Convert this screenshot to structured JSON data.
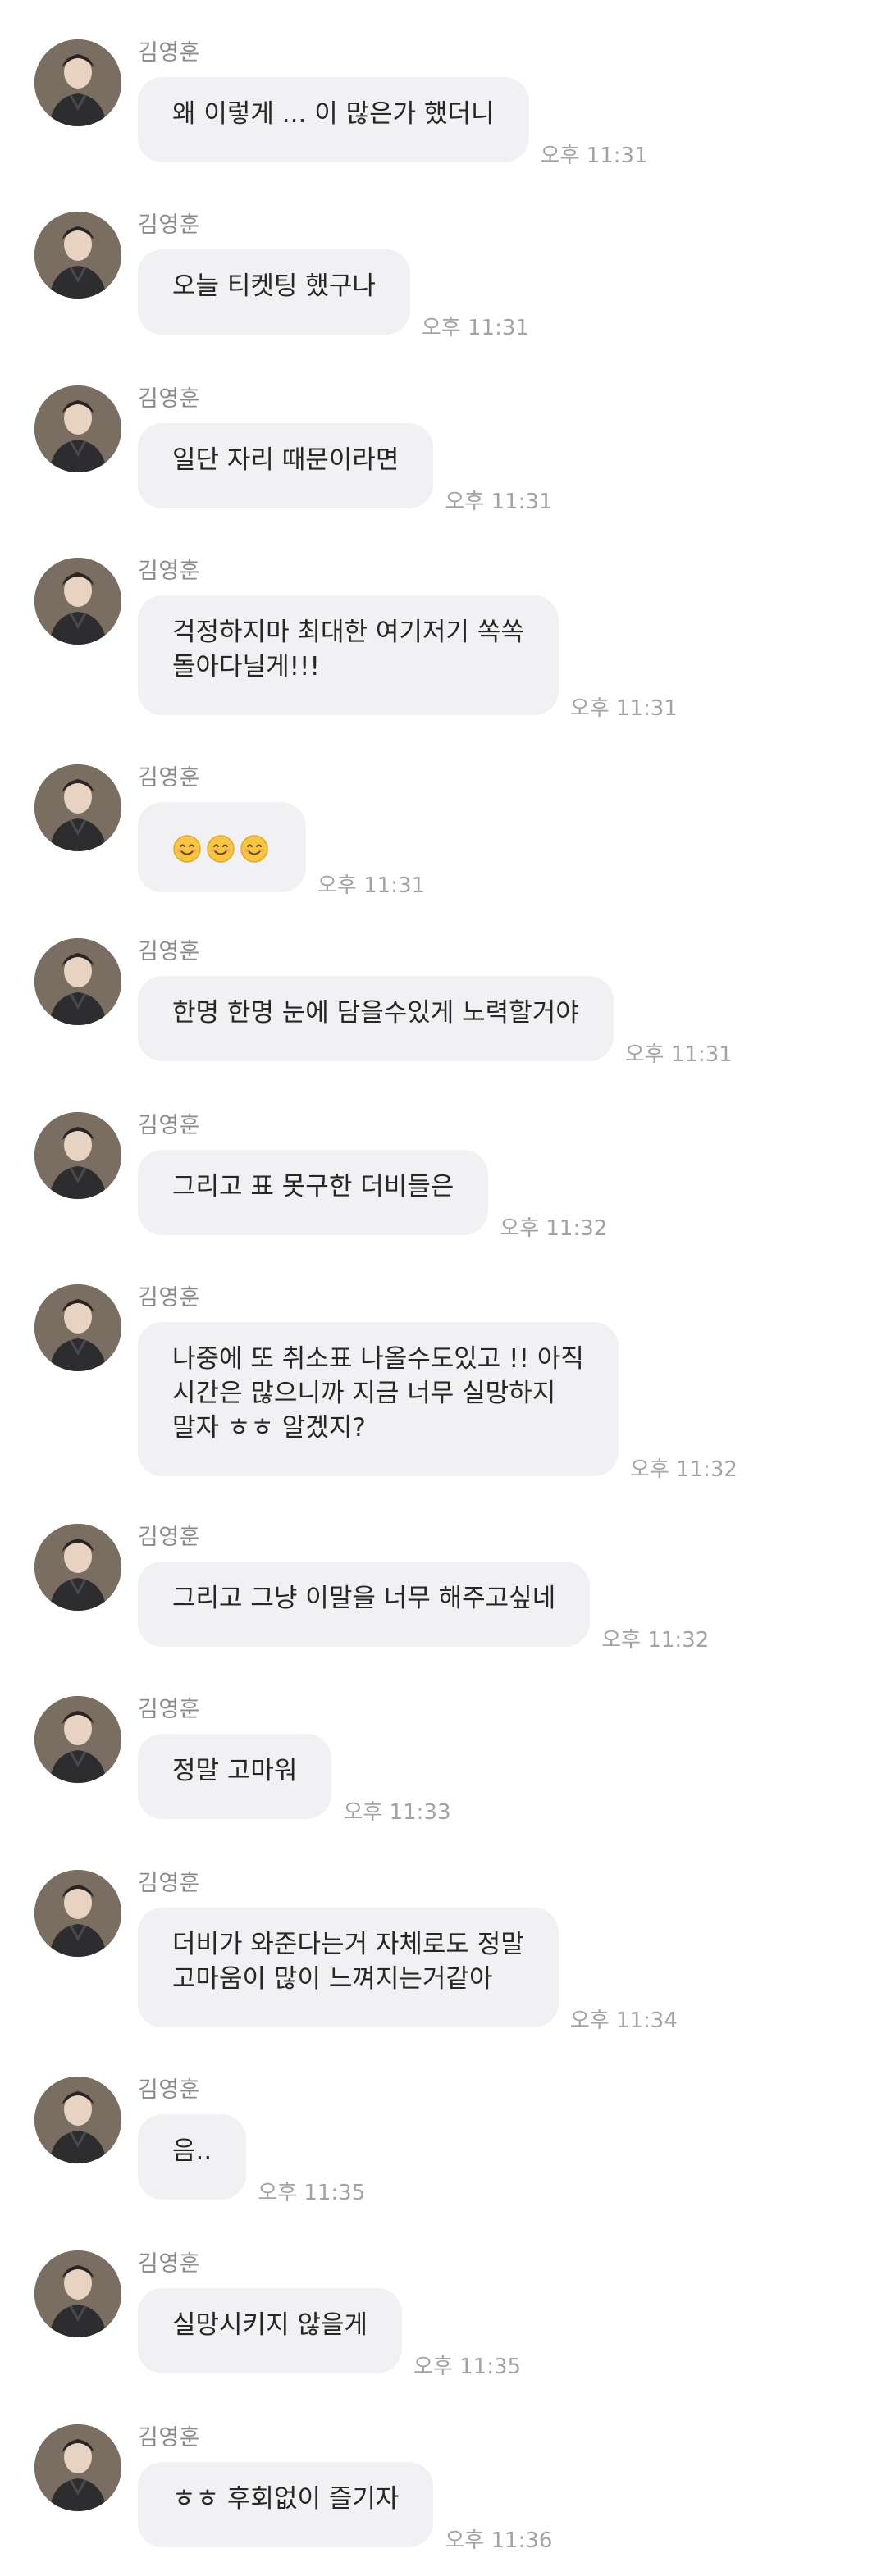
{
  "messages": [
    {
      "sender": "김영훈",
      "text": "왜 이렇게 ... 이 많은가 했더니",
      "time": "오후 11:31"
    },
    {
      "sender": "김영훈",
      "text": "오늘 티켓팅 했구나",
      "time": "오후 11:31"
    },
    {
      "sender": "김영훈",
      "text": "일단 자리 때문이라면",
      "time": "오후 11:31"
    },
    {
      "sender": "김영훈",
      "text": "걱정하지마 최대한 여기저기 쏙쏙\n돌아다닐게!!!",
      "time": "오후 11:31"
    },
    {
      "sender": "김영훈",
      "text": "",
      "emoji": [
        "smiling-face-icon",
        "smiling-face-icon",
        "smiling-face-icon"
      ],
      "time": "오후 11:31"
    },
    {
      "sender": "김영훈",
      "text": "한명 한명 눈에 담을수있게 노력할거야",
      "time": "오후 11:31"
    },
    {
      "sender": "김영훈",
      "text": "그리고 표 못구한 더비들은",
      "time": "오후 11:32"
    },
    {
      "sender": "김영훈",
      "text": "나중에 또 취소표 나올수도있고 !! 아직\n시간은 많으니까 지금 너무 실망하지\n말자 ㅎㅎ 알겠지?",
      "time": "오후 11:32"
    },
    {
      "sender": "김영훈",
      "text": "그리고 그냥 이말을 너무 해주고싶네",
      "time": "오후 11:32"
    },
    {
      "sender": "김영훈",
      "text": "정말 고마워",
      "time": "오후 11:33"
    },
    {
      "sender": "김영훈",
      "text": "더비가 와준다는거 자체로도 정말\n고마움이 많이 느껴지는거같아",
      "time": "오후 11:34"
    },
    {
      "sender": "김영훈",
      "text": "음..",
      "time": "오후 11:35"
    },
    {
      "sender": "김영훈",
      "text": "실망시키지 않을게",
      "time": "오후 11:35"
    },
    {
      "sender": "김영훈",
      "text": "ㅎㅎ 후회없이 즐기자",
      "time": "오후 11:36"
    }
  ],
  "colors": {
    "bubble": "#f1f1f4",
    "sender": "#8a8a8a",
    "time": "#a3a3a3",
    "text": "#262626",
    "emoji_face": "#f6c543"
  }
}
